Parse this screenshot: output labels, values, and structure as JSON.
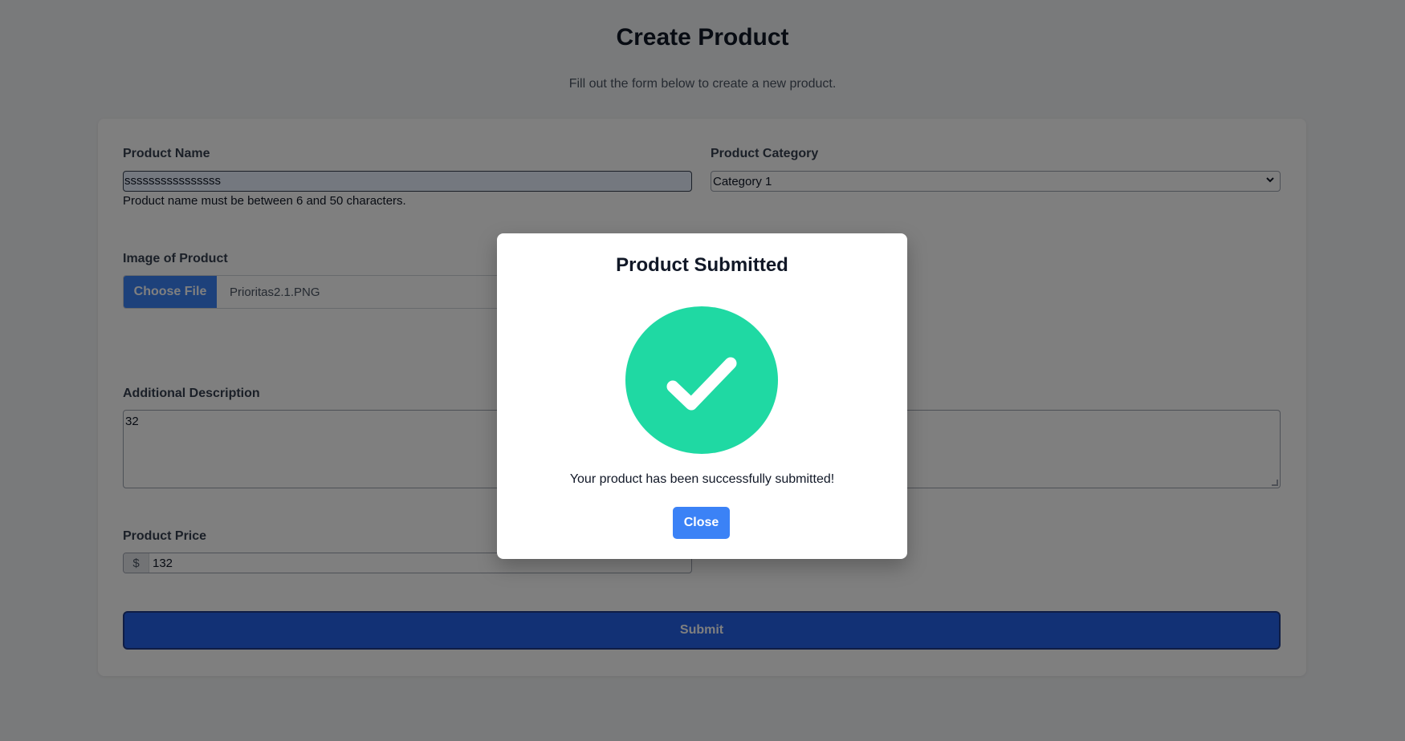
{
  "header": {
    "title": "Create Product",
    "subtitle": "Fill out the form below to create a new product."
  },
  "form": {
    "product_name": {
      "label": "Product Name",
      "value": "ssssssssssssssss",
      "helper": "Product name must be between 6 and 50 characters."
    },
    "product_category": {
      "label": "Product Category",
      "selected": "Category 1"
    },
    "image": {
      "label": "Image of Product",
      "button_label": "Choose File",
      "file_name": "Prioritas2.1.PNG"
    },
    "description": {
      "label": "Additional Description",
      "value": "32"
    },
    "price": {
      "label": "Product Price",
      "prefix": "$",
      "value": "132"
    },
    "submit_label": "Submit"
  },
  "modal": {
    "title": "Product Submitted",
    "message": "Your product has been successfully submitted!",
    "close_label": "Close",
    "icon": "check-circle-icon",
    "icon_color": "#1fd9a3"
  },
  "colors": {
    "primary": "#3b82f6",
    "overlay": "rgba(0,0,0,0.5)"
  }
}
